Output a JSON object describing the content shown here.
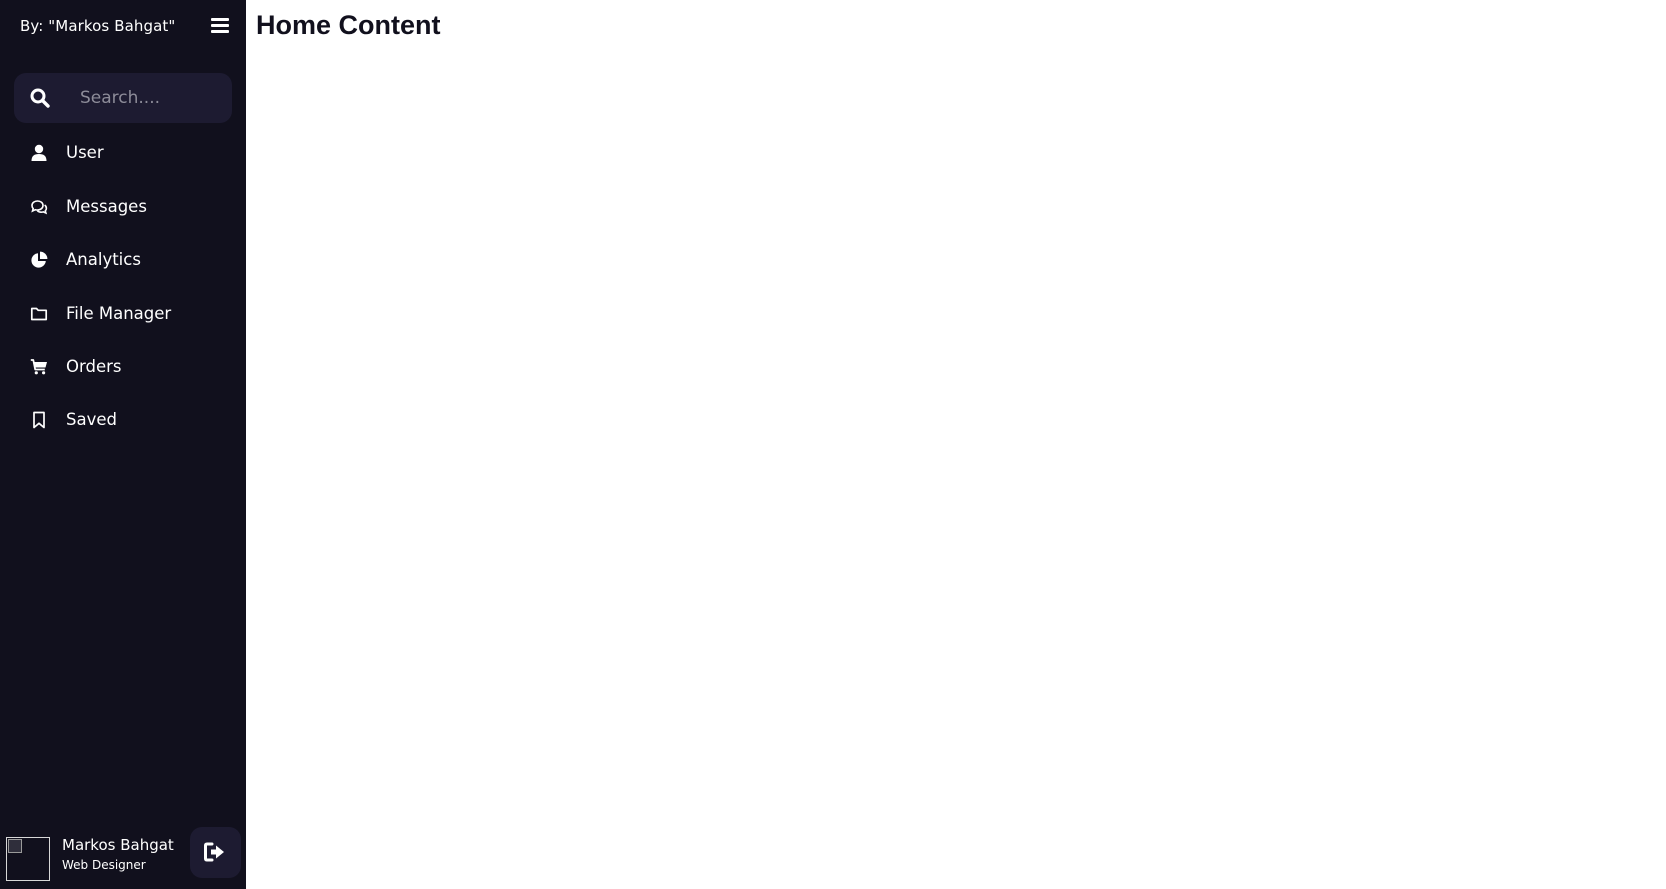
{
  "sidebar": {
    "logo_text": "By: \"Markos Bahgat\"",
    "menu_icon": "hamburger-menu-icon",
    "search": {
      "placeholder": "Search....",
      "value": ""
    },
    "items": [
      {
        "label": "User",
        "icon": "user-icon"
      },
      {
        "label": "Messages",
        "icon": "chat-icon"
      },
      {
        "label": "Analytics",
        "icon": "pie-chart-icon"
      },
      {
        "label": "File Manager",
        "icon": "folder-icon"
      },
      {
        "label": "Orders",
        "icon": "cart-icon"
      },
      {
        "label": "Saved",
        "icon": "bookmark-icon"
      }
    ],
    "profile": {
      "name": "Markos Bahgat",
      "job": "Web Designer",
      "logout_icon": "logout-icon"
    }
  },
  "main": {
    "title": "Home Content"
  },
  "colors": {
    "sidebar_bg": "#11101d",
    "input_bg": "#1d1b31",
    "text_light": "#ffffff",
    "title_text": "#11101d"
  }
}
